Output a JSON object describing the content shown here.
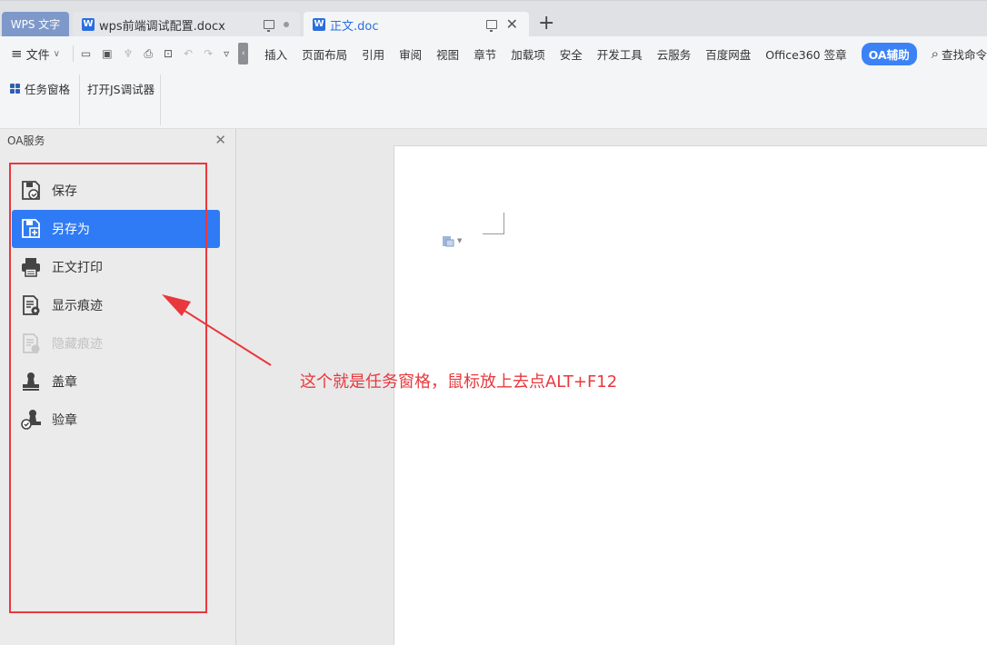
{
  "tabs": {
    "app_label": "WPS 文字",
    "docs": [
      {
        "icon": "W",
        "label": "wps前端调试配置.docx"
      },
      {
        "icon": "W",
        "label": "正文.doc"
      }
    ],
    "add_label": "+"
  },
  "menubar": {
    "file_label": "文件",
    "items": [
      "插入",
      "页面布局",
      "引用",
      "审阅",
      "视图",
      "章节",
      "加载项",
      "安全",
      "开发工具",
      "云服务",
      "百度网盘",
      "Office360 签章"
    ],
    "oa_label": "OA辅助",
    "search_label": "查找命令"
  },
  "ribbon": {
    "task_pane_label": "任务窗格",
    "js_debugger_label": "打开JS调试器"
  },
  "pane": {
    "title": "OA服务",
    "items": [
      {
        "label": "保存",
        "icon": "save-icon",
        "state": "normal"
      },
      {
        "label": "另存为",
        "icon": "save-as-icon",
        "state": "active"
      },
      {
        "label": "正文打印",
        "icon": "printer-icon",
        "state": "normal"
      },
      {
        "label": "显示痕迹",
        "icon": "show-revisions-icon",
        "state": "normal"
      },
      {
        "label": "隐藏痕迹",
        "icon": "hide-revisions-icon",
        "state": "disabled"
      },
      {
        "label": "盖章",
        "icon": "stamp-icon",
        "state": "normal"
      },
      {
        "label": "验章",
        "icon": "verify-stamp-icon",
        "state": "normal"
      }
    ]
  },
  "annotation": {
    "text": "这个就是任务窗格，鼠标放上去点ALT+F12",
    "color": "#e8383d"
  },
  "colors": {
    "accent": "#2f7bf5",
    "oa_badge": "#3b82f6",
    "annotation": "#e8383d"
  }
}
